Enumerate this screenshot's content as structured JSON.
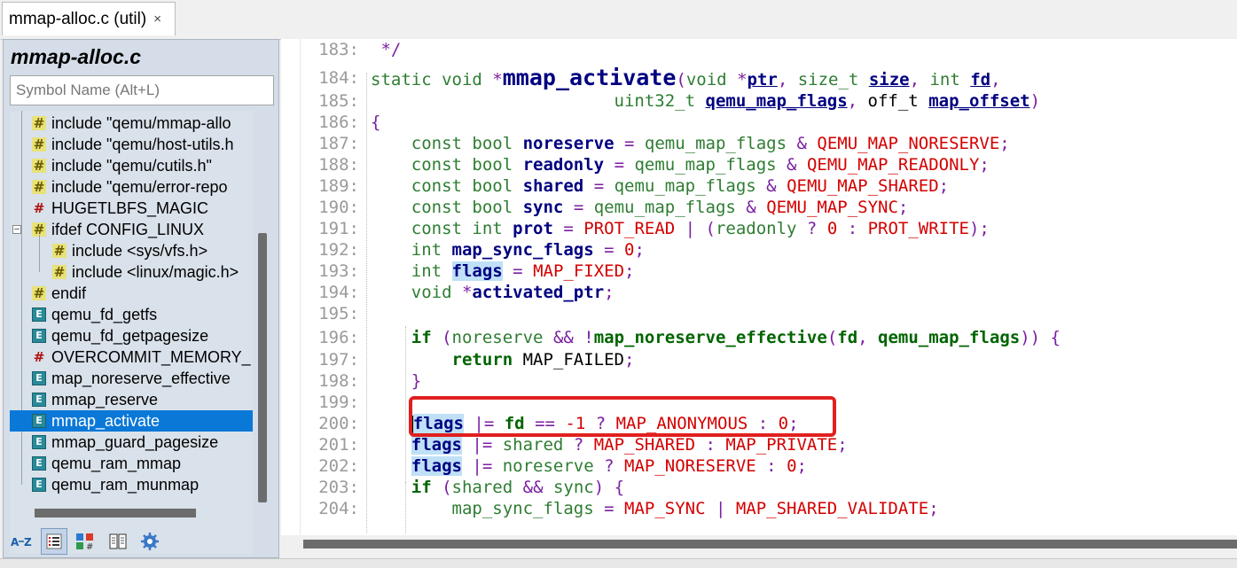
{
  "tab": {
    "title": "mmap-alloc.c (util)",
    "close": "×"
  },
  "sidebar": {
    "title": "mmap-alloc.c",
    "search_placeholder": "Symbol Name (Alt+L)",
    "items": [
      {
        "icon": "hash-icon",
        "label": "include \"qemu/mmap-allo",
        "indent": 0
      },
      {
        "icon": "hash-icon",
        "label": "include \"qemu/host-utils.h",
        "indent": 0
      },
      {
        "icon": "hash-icon",
        "label": "include \"qemu/cutils.h\"",
        "indent": 0
      },
      {
        "icon": "hash-icon",
        "label": "include \"qemu/error-repo",
        "indent": 0
      },
      {
        "icon": "define-icon",
        "label": "HUGETLBFS_MAGIC",
        "indent": 0
      },
      {
        "icon": "hash-icon",
        "label": "ifdef CONFIG_LINUX",
        "indent": 0
      },
      {
        "icon": "hash-icon",
        "label": "include <sys/vfs.h>",
        "indent": 1
      },
      {
        "icon": "hash-icon",
        "label": "include <linux/magic.h>",
        "indent": 1
      },
      {
        "icon": "hash-icon",
        "label": "endif",
        "indent": 0
      },
      {
        "icon": "function-icon",
        "label": "qemu_fd_getfs",
        "indent": 0
      },
      {
        "icon": "function-icon",
        "label": "qemu_fd_getpagesize",
        "indent": 0
      },
      {
        "icon": "define-icon",
        "label": "OVERCOMMIT_MEMORY_",
        "indent": 0
      },
      {
        "icon": "function-icon",
        "label": "map_noreserve_effective",
        "indent": 0
      },
      {
        "icon": "function-icon",
        "label": "mmap_reserve",
        "indent": 0
      },
      {
        "icon": "function-icon",
        "label": "mmap_activate",
        "indent": 0,
        "selected": true
      },
      {
        "icon": "function-icon",
        "label": "mmap_guard_pagesize",
        "indent": 0
      },
      {
        "icon": "function-icon",
        "label": "qemu_ram_mmap",
        "indent": 0
      },
      {
        "icon": "function-icon",
        "label": "qemu_ram_munmap",
        "indent": 0
      }
    ],
    "toolbar": [
      "sort-az-icon",
      "list-view-icon",
      "symbol-types-icon",
      "book-icon",
      "settings-icon"
    ]
  },
  "editor": {
    "lines": [
      {
        "num": "183:",
        "tokens": [
          [
            "plain",
            " "
          ],
          [
            "op",
            "*/"
          ]
        ]
      },
      {
        "num": "184:",
        "tokens": [
          [
            "kw",
            "static void "
          ],
          [
            "op",
            "*"
          ],
          [
            "funcname",
            "mmap_activate"
          ],
          [
            "op",
            "("
          ],
          [
            "kw",
            "void "
          ],
          [
            "op",
            "*"
          ],
          [
            "idu",
            "ptr"
          ],
          [
            "op",
            ", "
          ],
          [
            "kw",
            "size_t "
          ],
          [
            "idu",
            "size"
          ],
          [
            "op",
            ", "
          ],
          [
            "kw",
            "int "
          ],
          [
            "idu",
            "fd"
          ],
          [
            "op",
            ","
          ]
        ]
      },
      {
        "num": "185:",
        "tokens": [
          [
            "plain",
            "                        "
          ],
          [
            "kw",
            "uint32_t "
          ],
          [
            "idu",
            "qemu_map_flags"
          ],
          [
            "op",
            ", "
          ],
          [
            "plain",
            "off_t "
          ],
          [
            "idu",
            "map_offset"
          ],
          [
            "op",
            ")"
          ]
        ]
      },
      {
        "num": "186:",
        "tokens": [
          [
            "op",
            "{"
          ]
        ]
      },
      {
        "num": "187:",
        "tokens": [
          [
            "plain",
            "    "
          ],
          [
            "kw",
            "const bool "
          ],
          [
            "id",
            "noreserve"
          ],
          [
            "op",
            " = "
          ],
          [
            "kw",
            "qemu_map_flags"
          ],
          [
            "op",
            " & "
          ],
          [
            "mac",
            "QEMU_MAP_NORESERVE"
          ],
          [
            "op",
            ";"
          ]
        ]
      },
      {
        "num": "188:",
        "tokens": [
          [
            "plain",
            "    "
          ],
          [
            "kw",
            "const bool "
          ],
          [
            "id",
            "readonly"
          ],
          [
            "op",
            " = "
          ],
          [
            "kw",
            "qemu_map_flags"
          ],
          [
            "op",
            " & "
          ],
          [
            "mac",
            "QEMU_MAP_READONLY"
          ],
          [
            "op",
            ";"
          ]
        ]
      },
      {
        "num": "189:",
        "tokens": [
          [
            "plain",
            "    "
          ],
          [
            "kw",
            "const bool "
          ],
          [
            "id",
            "shared"
          ],
          [
            "op",
            " = "
          ],
          [
            "kw",
            "qemu_map_flags"
          ],
          [
            "op",
            " & "
          ],
          [
            "mac",
            "QEMU_MAP_SHARED"
          ],
          [
            "op",
            ";"
          ]
        ]
      },
      {
        "num": "190:",
        "tokens": [
          [
            "plain",
            "    "
          ],
          [
            "kw",
            "const bool "
          ],
          [
            "id",
            "sync"
          ],
          [
            "op",
            " = "
          ],
          [
            "kw",
            "qemu_map_flags"
          ],
          [
            "op",
            " & "
          ],
          [
            "mac",
            "QEMU_MAP_SYNC"
          ],
          [
            "op",
            ";"
          ]
        ]
      },
      {
        "num": "191:",
        "tokens": [
          [
            "plain",
            "    "
          ],
          [
            "kw",
            "const int "
          ],
          [
            "id",
            "prot"
          ],
          [
            "op",
            " = "
          ],
          [
            "mac",
            "PROT_READ"
          ],
          [
            "op",
            " | ("
          ],
          [
            "kw",
            "readonly"
          ],
          [
            "op",
            " ? "
          ],
          [
            "num",
            "0"
          ],
          [
            "op",
            " : "
          ],
          [
            "mac",
            "PROT_WRITE"
          ],
          [
            "op",
            ");"
          ]
        ]
      },
      {
        "num": "192:",
        "tokens": [
          [
            "plain",
            "    "
          ],
          [
            "kw",
            "int "
          ],
          [
            "id",
            "map_sync_flags"
          ],
          [
            "op",
            " = "
          ],
          [
            "num",
            "0"
          ],
          [
            "op",
            ";"
          ]
        ]
      },
      {
        "num": "193:",
        "tokens": [
          [
            "plain",
            "    "
          ],
          [
            "kw",
            "int "
          ],
          [
            "idhl",
            "flags"
          ],
          [
            "op",
            " = "
          ],
          [
            "mac",
            "MAP_FIXED"
          ],
          [
            "op",
            ";"
          ]
        ]
      },
      {
        "num": "194:",
        "tokens": [
          [
            "plain",
            "    "
          ],
          [
            "kw",
            "void "
          ],
          [
            "op",
            "*"
          ],
          [
            "id",
            "activated_ptr"
          ],
          [
            "op",
            ";"
          ]
        ]
      },
      {
        "num": "195:",
        "tokens": []
      },
      {
        "num": "196:",
        "tokens": [
          [
            "plain",
            "    "
          ],
          [
            "kwd",
            "if"
          ],
          [
            "op",
            " ("
          ],
          [
            "kw",
            "noreserve"
          ],
          [
            "op",
            " && !"
          ],
          [
            "kwdb",
            "map_noreserve_effective"
          ],
          [
            "op",
            "("
          ],
          [
            "kwdb",
            "fd"
          ],
          [
            "op",
            ", "
          ],
          [
            "kwdb",
            "qemu_map_flags"
          ],
          [
            "op",
            ")) {"
          ]
        ]
      },
      {
        "num": "197:",
        "tokens": [
          [
            "plain",
            "        "
          ],
          [
            "kwdb",
            "return "
          ],
          [
            "plain",
            "MAP_FAILED"
          ],
          [
            "op",
            ";"
          ]
        ]
      },
      {
        "num": "198:",
        "tokens": [
          [
            "plain",
            "    "
          ],
          [
            "op",
            "}"
          ]
        ]
      },
      {
        "num": "199:",
        "tokens": []
      },
      {
        "num": "200:",
        "tokens": [
          [
            "plain",
            "    "
          ],
          [
            "cursor",
            ""
          ],
          [
            "kwhl",
            "flags"
          ],
          [
            "op",
            " |= "
          ],
          [
            "kwdb",
            "fd"
          ],
          [
            "op",
            " == "
          ],
          [
            "num",
            "-1"
          ],
          [
            "op",
            " ? "
          ],
          [
            "mac",
            "MAP_ANONYMOUS"
          ],
          [
            "op",
            " : "
          ],
          [
            "num",
            "0"
          ],
          [
            "op",
            ";"
          ]
        ]
      },
      {
        "num": "201:",
        "tokens": [
          [
            "plain",
            "    "
          ],
          [
            "kwhl",
            "flags"
          ],
          [
            "op",
            " |= "
          ],
          [
            "kw",
            "shared"
          ],
          [
            "op",
            " ? "
          ],
          [
            "mac",
            "MAP_SHARED"
          ],
          [
            "op",
            " : "
          ],
          [
            "mac",
            "MAP_PRIVATE"
          ],
          [
            "op",
            ";"
          ]
        ]
      },
      {
        "num": "202:",
        "tokens": [
          [
            "plain",
            "    "
          ],
          [
            "kwhl",
            "flags"
          ],
          [
            "op",
            " |= "
          ],
          [
            "kw",
            "noreserve"
          ],
          [
            "op",
            " ? "
          ],
          [
            "mac",
            "MAP_NORESERVE"
          ],
          [
            "op",
            " : "
          ],
          [
            "num",
            "0"
          ],
          [
            "op",
            ";"
          ]
        ]
      },
      {
        "num": "203:",
        "tokens": [
          [
            "plain",
            "    "
          ],
          [
            "kwd",
            "if"
          ],
          [
            "op",
            " ("
          ],
          [
            "kw",
            "shared"
          ],
          [
            "op",
            " && "
          ],
          [
            "kw",
            "sync"
          ],
          [
            "op",
            ") {"
          ]
        ]
      },
      {
        "num": "204:",
        "tokens": [
          [
            "plain",
            "        "
          ],
          [
            "kw",
            "map_sync_flags"
          ],
          [
            "op",
            " = "
          ],
          [
            "mac",
            "MAP_SYNC"
          ],
          [
            "op",
            " | "
          ],
          [
            "mac",
            "MAP_SHARED_VALIDATE"
          ],
          [
            "op",
            ";"
          ]
        ]
      }
    ]
  },
  "colors": {
    "selection": "#0a78d7",
    "highlight_box": "#e0201f",
    "ident_highlight": "#bfe0f7"
  }
}
